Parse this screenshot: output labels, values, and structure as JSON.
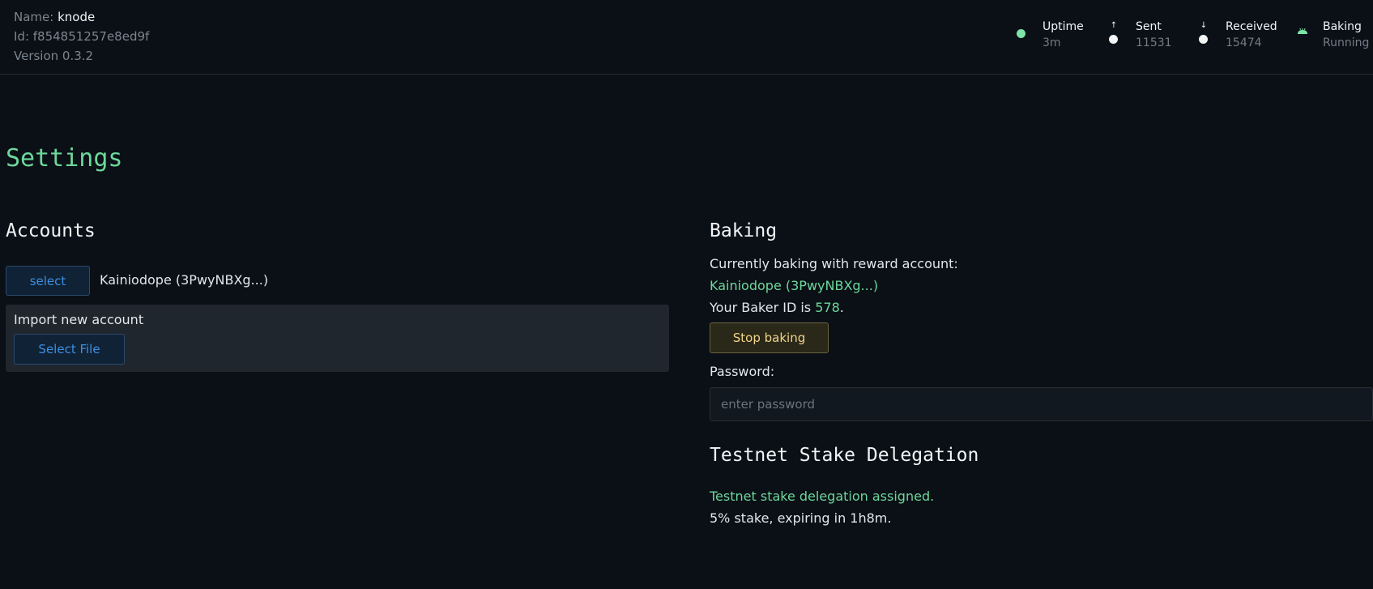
{
  "header": {
    "name_label": "Name:",
    "name_value": "knode",
    "id_text": "Id: f854851257e8ed9f",
    "version_text": "Version 0.3.2",
    "stats": [
      {
        "label": "Uptime",
        "value": "3m",
        "icon": "green-dot-icon"
      },
      {
        "label": "Sent",
        "value": "11531",
        "icon": "arrow-up-icon"
      },
      {
        "label": "Received",
        "value": "15474",
        "icon": "arrow-down-icon"
      },
      {
        "label": "Baking",
        "value": "Running",
        "icon": "bread-icon"
      }
    ]
  },
  "page": {
    "title": "Settings"
  },
  "accounts": {
    "title": "Accounts",
    "select_label": "select",
    "account_name": "Kainiodope (3PwyNBXg...)",
    "import_label": "Import new account",
    "select_file_label": "Select File"
  },
  "baking": {
    "title": "Baking",
    "currently_text": "Currently baking with reward account:",
    "reward_account": "Kainiodope (3PwyNBXg...)",
    "baker_id_prefix": "Your Baker ID is ",
    "baker_id": "578",
    "baker_id_suffix": ".",
    "stop_label": "Stop baking",
    "password_label": "Password:",
    "password_placeholder": "enter password"
  },
  "delegation": {
    "title": "Testnet Stake Delegation",
    "status": "Testnet stake delegation assigned.",
    "details": "5% stake, expiring in 1h8m."
  },
  "colors": {
    "background": "#0b1016",
    "accent_green": "#6dd79c",
    "accent_blue": "#3d8fe0",
    "warning_yellow": "#f0d48a"
  }
}
